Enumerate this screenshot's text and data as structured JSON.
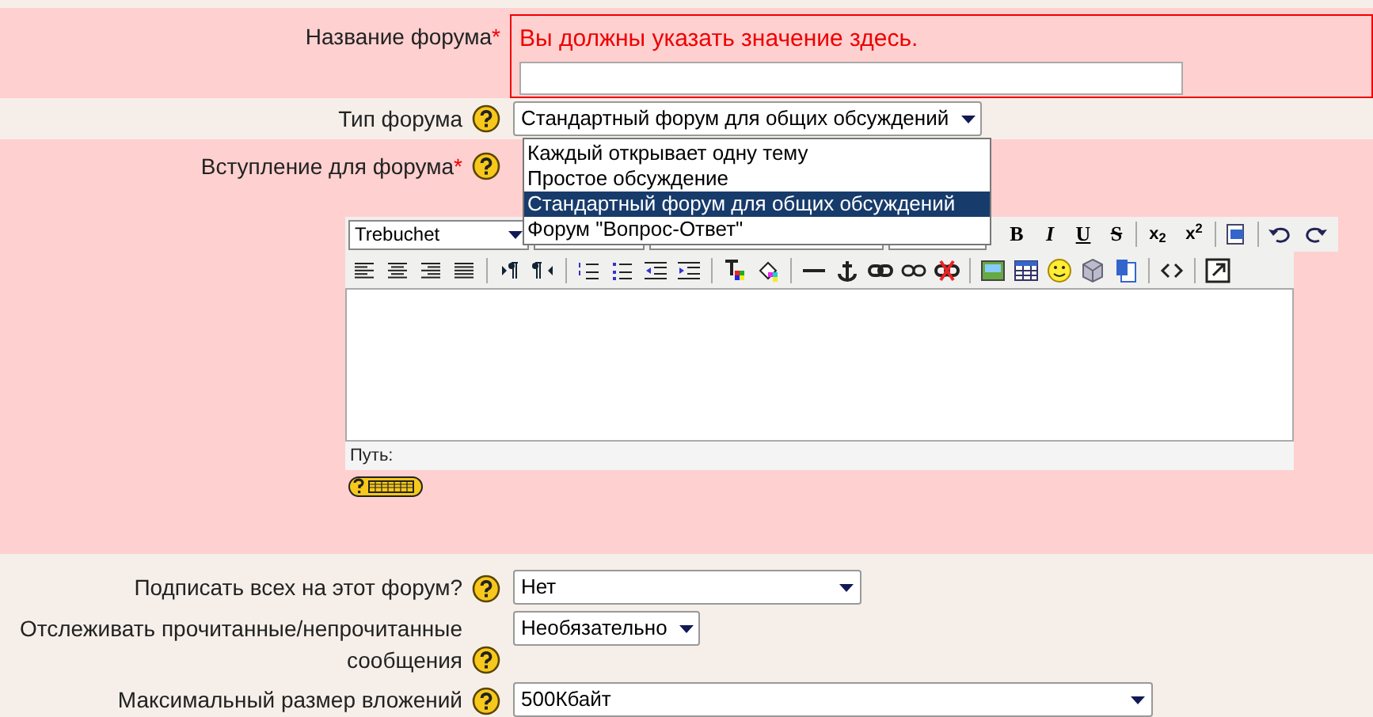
{
  "fields": [
    {
      "kind": "text",
      "label": "Название форума",
      "required_mark": "*",
      "error": "Вы должны указать значение здесь."
    },
    {
      "kind": "select",
      "label": "Тип форума",
      "help": true,
      "value": "Стандартный форум для общих обсуждений",
      "options": [
        {
          "label": "Каждый открывает одну тему",
          "selected": false
        },
        {
          "label": "Простое обсуждение",
          "selected": false
        },
        {
          "label": "Стандартный форум для общих обсуждений",
          "selected": true
        },
        {
          "label": "Форум \"Вопрос-Ответ\"",
          "selected": false
        }
      ]
    },
    {
      "kind": "editor",
      "label": "Вступление для форума",
      "required_mark": "*",
      "help": true,
      "font": "Trebuchet",
      "format_buttons": [
        "B",
        "I",
        "U",
        "S"
      ],
      "script_buttons": [
        "x$_{2}$",
        "x$^{2}$"
      ],
      "path_label": "Путь:"
    },
    {
      "kind": "select",
      "label": "Подписать всех на этот форум?",
      "help": true,
      "value": "Нет"
    },
    {
      "kind": "select",
      "label": "Отслеживать прочитанные/непрочитанные сообщения",
      "help": true,
      "value": "Необязательно"
    },
    {
      "kind": "select",
      "label": "Максимальный размер вложений",
      "help": true,
      "value": "500Кбайт"
    }
  ]
}
